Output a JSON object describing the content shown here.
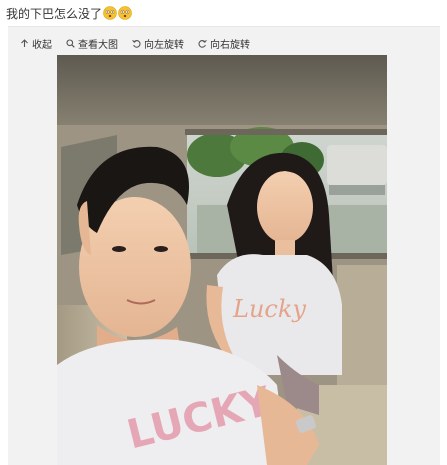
{
  "post": {
    "text": "我的下巴怎么没了",
    "emoji_1": "dizzy-face-emoji",
    "emoji_2": "dizzy-face-emoji"
  },
  "toolbar": {
    "collapse_label": "收起",
    "collapse_icon": "arrow-up-icon",
    "view_large_label": "查看大图",
    "view_large_icon": "magnifier-icon",
    "rotate_left_label": "向左旋转",
    "rotate_left_icon": "rotate-left-icon",
    "rotate_right_label": "向右旋转",
    "rotate_right_icon": "rotate-right-icon"
  },
  "photo": {
    "subject": "selfie-in-car",
    "shirt_text_front": "LUCKY",
    "shirt_text_back": "Lucky"
  },
  "colors": {
    "card_bg": "#f2f2f2",
    "text": "#333333",
    "emoji": "#f5c330"
  }
}
